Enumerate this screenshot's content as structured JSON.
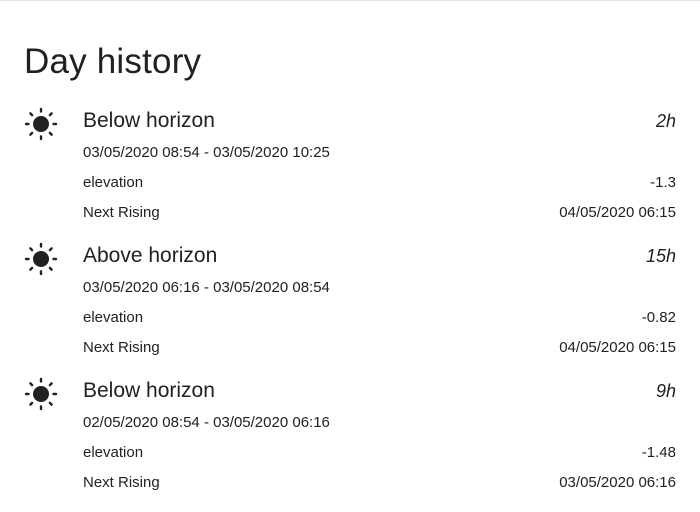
{
  "page": {
    "title": "Day history"
  },
  "entries": [
    {
      "icon": "sun-icon",
      "state": "Below horizon",
      "duration": "2h",
      "range": "03/05/2020 08:54 - 03/05/2020 10:25",
      "attributes": [
        {
          "name": "elevation",
          "value": "-1.3"
        },
        {
          "name": "Next Rising",
          "value": "04/05/2020 06:15"
        }
      ]
    },
    {
      "icon": "sun-icon",
      "state": "Above horizon",
      "duration": "15h",
      "range": "03/05/2020 06:16 - 03/05/2020 08:54",
      "attributes": [
        {
          "name": "elevation",
          "value": "-0.82"
        },
        {
          "name": "Next Rising",
          "value": "04/05/2020 06:15"
        }
      ]
    },
    {
      "icon": "sun-icon",
      "state": "Below horizon",
      "duration": "9h",
      "range": "02/05/2020 08:54 - 03/05/2020 06:16",
      "attributes": [
        {
          "name": "elevation",
          "value": "-1.48"
        },
        {
          "name": "Next Rising",
          "value": "03/05/2020 06:16"
        }
      ]
    }
  ]
}
